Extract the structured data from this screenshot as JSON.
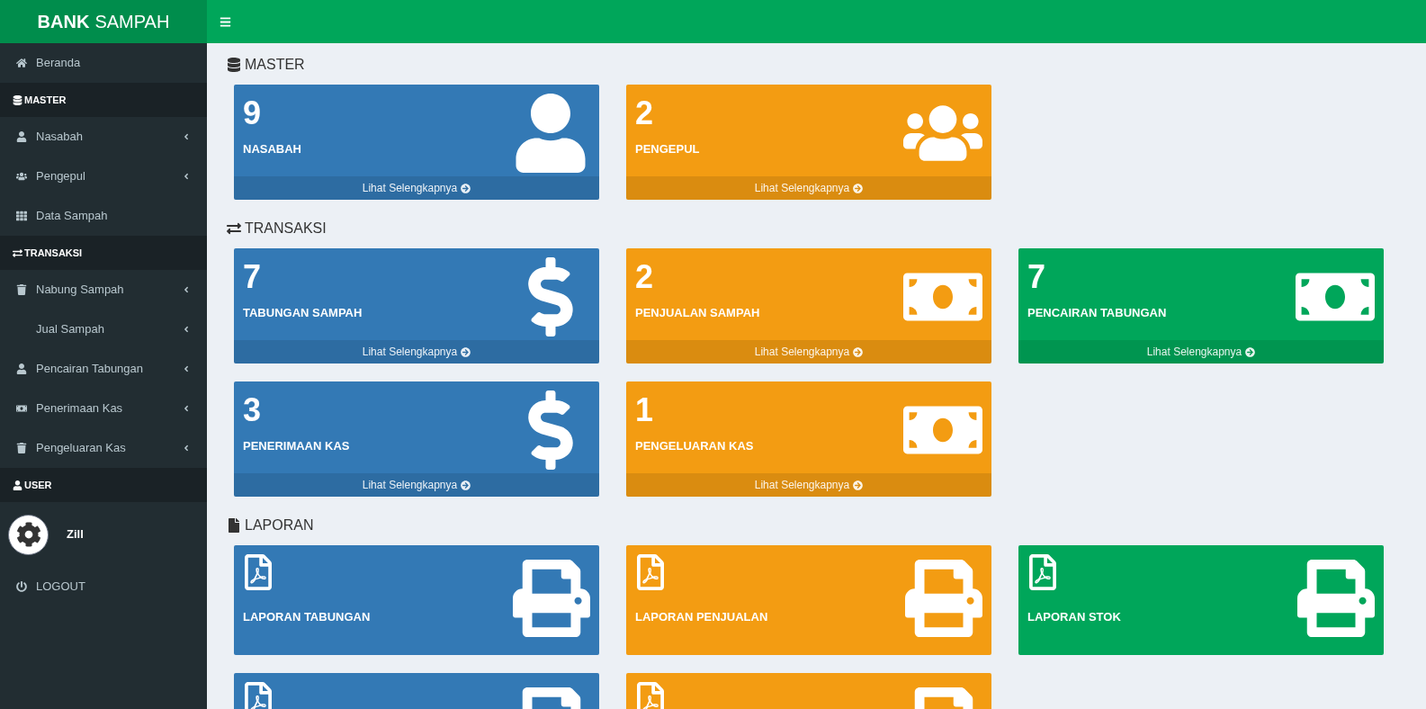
{
  "brand": {
    "bold": "BANK",
    "rest": "SAMPAH"
  },
  "sidebar": {
    "items": [
      {
        "kind": "link",
        "label": "Beranda",
        "expandable": false
      },
      {
        "kind": "header",
        "label": "MASTER"
      },
      {
        "kind": "link",
        "label": "Nasabah",
        "expandable": true
      },
      {
        "kind": "link",
        "label": "Pengepul",
        "expandable": true
      },
      {
        "kind": "link",
        "label": "Data Sampah",
        "expandable": false
      },
      {
        "kind": "header",
        "label": "TRANSAKSI"
      },
      {
        "kind": "link",
        "label": "Nabung Sampah",
        "expandable": true
      },
      {
        "kind": "link",
        "label": "Jual Sampah",
        "expandable": true
      },
      {
        "kind": "link",
        "label": "Pencairan Tabungan",
        "expandable": true
      },
      {
        "kind": "link",
        "label": "Penerimaan Kas",
        "expandable": true
      },
      {
        "kind": "link",
        "label": "Pengeluaran Kas",
        "expandable": true
      },
      {
        "kind": "header",
        "label": "USER"
      },
      {
        "kind": "user",
        "label": "Zill"
      },
      {
        "kind": "link",
        "label": "LOGOUT",
        "expandable": false
      }
    ]
  },
  "sections": [
    {
      "title": "MASTER",
      "cards": [
        {
          "kind": "stat",
          "value": "9",
          "label": "NASABAH",
          "footer": "Lihat Selengkapnya",
          "color": "#3379b5"
        },
        {
          "kind": "stat",
          "value": "2",
          "label": "PENGEPUL",
          "footer": "Lihat Selengkapnya",
          "color": "#f39c12"
        }
      ]
    },
    {
      "title": "TRANSAKSI",
      "cards": [
        {
          "kind": "stat",
          "value": "7",
          "label": "TABUNGAN SAMPAH",
          "footer": "Lihat Selengkapnya",
          "color": "#3379b5"
        },
        {
          "kind": "stat",
          "value": "2",
          "label": "PENJUALAN SAMPAH",
          "footer": "Lihat Selengkapnya",
          "color": "#f39c12"
        },
        {
          "kind": "stat",
          "value": "7",
          "label": "PENCAIRAN TABUNGAN",
          "footer": "Lihat Selengkapnya",
          "color": "#00a65a"
        },
        {
          "kind": "stat",
          "value": "3",
          "label": "PENERIMAAN KAS",
          "footer": "Lihat Selengkapnya",
          "color": "#3379b5"
        },
        {
          "kind": "stat",
          "value": "1",
          "label": "PENGELUARAN KAS",
          "footer": "Lihat Selengkapnya",
          "color": "#f39c12"
        }
      ]
    },
    {
      "title": "LAPORAN",
      "cards": [
        {
          "kind": "report",
          "label": "LAPORAN TABUNGAN",
          "color": "#3379b5"
        },
        {
          "kind": "report",
          "label": "LAPORAN PENJUALAN",
          "color": "#f39c12"
        },
        {
          "kind": "report",
          "label": "LAPORAN STOK",
          "color": "#00a65a"
        },
        {
          "kind": "report",
          "color": "#3379b5"
        },
        {
          "kind": "report",
          "color": "#f39c12"
        }
      ]
    }
  ]
}
